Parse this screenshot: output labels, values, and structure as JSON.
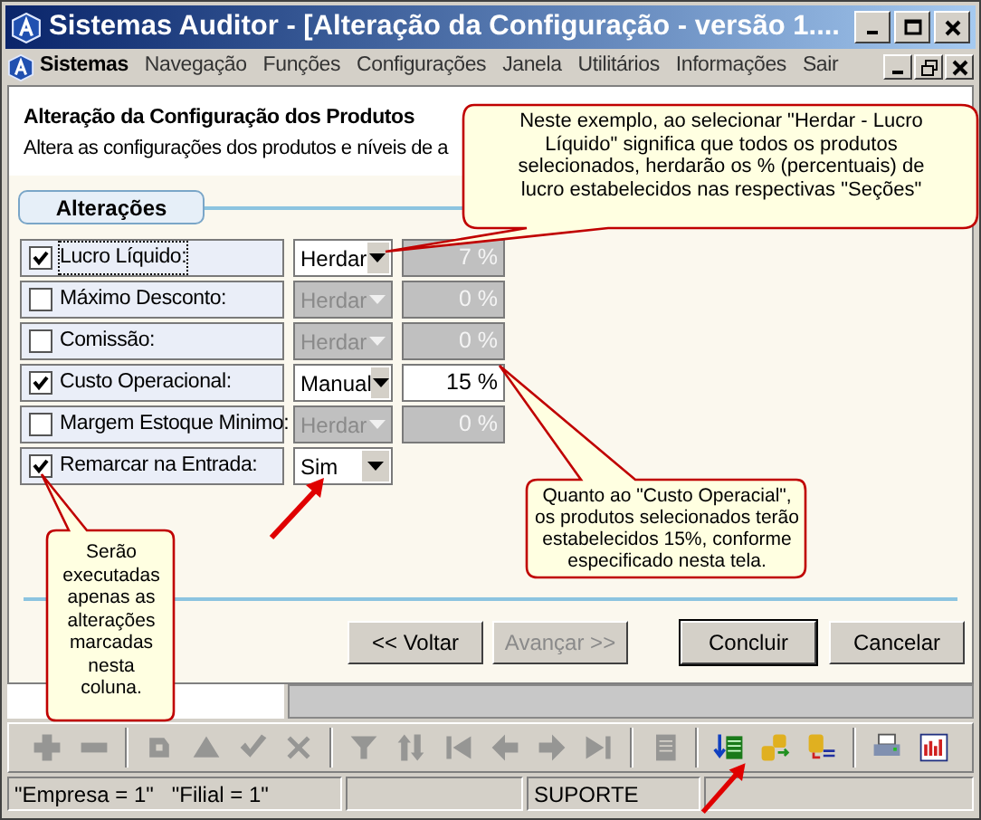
{
  "window": {
    "title": "Sistemas Auditor - [Alteração da Configuração - versão 1...."
  },
  "menu": [
    {
      "label": "Sistemas",
      "kind": "app"
    },
    {
      "label": "Navegação",
      "kind": "item"
    },
    {
      "label": "Funções",
      "kind": "item"
    },
    {
      "label": "Configurações",
      "kind": "item"
    },
    {
      "label": "Janela",
      "kind": "item"
    },
    {
      "label": "Utilitários",
      "kind": "item"
    },
    {
      "label": "Informações",
      "kind": "item"
    },
    {
      "label": "Sair",
      "kind": "item"
    }
  ],
  "header": {
    "title": "Alteração da Configuração dos Produtos",
    "subtitle": "Altera as configurações dos produtos e níveis de a"
  },
  "tab": {
    "label": "Alterações",
    "selected": true
  },
  "rows": [
    {
      "label": "Lucro Líquido:",
      "checked": true,
      "focused": true,
      "mode": {
        "value": "Herdar",
        "disabled": false
      },
      "amount": {
        "value": "7 %",
        "disabled": true
      }
    },
    {
      "label": "Máximo Desconto:",
      "checked": false,
      "focused": false,
      "mode": {
        "value": "Herdar",
        "disabled": true
      },
      "amount": {
        "value": "0 %",
        "disabled": true
      }
    },
    {
      "label": "Comissão:",
      "checked": false,
      "focused": false,
      "mode": {
        "value": "Herdar",
        "disabled": true
      },
      "amount": {
        "value": "0 %",
        "disabled": true
      }
    },
    {
      "label": "Custo Operacional:",
      "checked": true,
      "focused": false,
      "mode": {
        "value": "Manual",
        "disabled": false
      },
      "amount": {
        "value": "15 %",
        "disabled": false
      }
    },
    {
      "label": "Margem Estoque Minimo:",
      "checked": false,
      "focused": false,
      "mode": {
        "value": "Herdar",
        "disabled": true
      },
      "amount": {
        "value": "0 %",
        "disabled": true
      }
    },
    {
      "label": "Remarcar na Entrada:",
      "checked": true,
      "focused": false,
      "mode": {
        "value": "Sim",
        "disabled": false
      }
    }
  ],
  "buttons": [
    {
      "label": "<< Voltar",
      "disabled": false,
      "default": false
    },
    {
      "label": "Avançar >>",
      "disabled": true,
      "default": false
    },
    {
      "label": "Concluir",
      "disabled": false,
      "default": true
    },
    {
      "label": "Cancelar",
      "disabled": false,
      "default": false
    }
  ],
  "toolbar": [
    [
      {
        "kind": "plus",
        "disabled": true
      },
      {
        "kind": "minus",
        "disabled": true
      }
    ],
    [
      {
        "kind": "refresh",
        "disabled": true
      },
      {
        "kind": "up",
        "disabled": true
      },
      {
        "kind": "check",
        "disabled": true
      },
      {
        "kind": "cross",
        "disabled": true
      }
    ],
    [
      {
        "kind": "funnel",
        "disabled": true
      },
      {
        "kind": "sort",
        "disabled": true
      },
      {
        "kind": "first",
        "disabled": true
      },
      {
        "kind": "prev",
        "disabled": true
      },
      {
        "kind": "next",
        "disabled": true
      },
      {
        "kind": "last",
        "disabled": true
      }
    ],
    [
      {
        "kind": "doc",
        "disabled": true
      }
    ],
    [
      {
        "kind": "listin",
        "disabled": false
      },
      {
        "kind": "dbswap",
        "disabled": false
      },
      {
        "kind": "dblist",
        "disabled": false
      }
    ],
    [
      {
        "kind": "printer",
        "disabled": false
      },
      {
        "kind": "chart",
        "disabled": false
      }
    ]
  ],
  "status_bar": [
    "\"Empresa = 1\"   \"Filial = 1\"",
    "SUPORTE"
  ],
  "callouts": [
    {
      "text": "Neste exemplo, ao selecionar \"Herdar - Lucro Líquido\" significa que todos os produtos selecionados, herdarão os % (percentuais) de lucro estabelecidos nas respectivas \"Seções\""
    },
    {
      "text": "Quanto ao \"Custo Operacial\", os produtos selecionados terão estabelecidos 15%, conforme especificado nesta tela."
    },
    {
      "text": "Serão executadas apenas as alterações marcadas nesta coluna."
    }
  ]
}
